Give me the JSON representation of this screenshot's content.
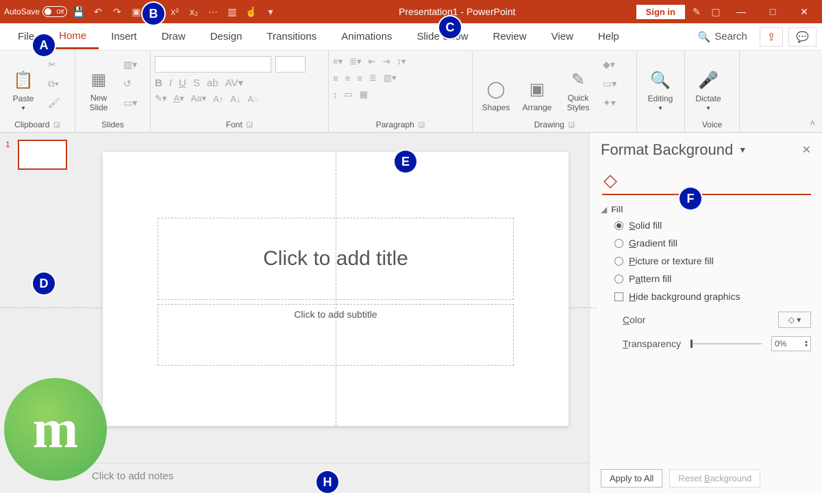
{
  "titlebar": {
    "autosave_label": "AutoSave",
    "autosave_state": "Off",
    "doc_title": "Presentation1 - PowerPoint",
    "signin": "Sign in"
  },
  "menu": {
    "tabs": [
      "File",
      "Home",
      "Insert",
      "Draw",
      "Design",
      "Transitions",
      "Animations",
      "Slide Show",
      "Review",
      "View",
      "Help"
    ],
    "active": "Home",
    "search": "Search"
  },
  "groups": {
    "clipboard": {
      "label": "Clipboard",
      "paste": "Paste"
    },
    "slides": {
      "label": "Slides",
      "newslide": "New\nSlide"
    },
    "font": {
      "label": "Font"
    },
    "paragraph": {
      "label": "Paragraph"
    },
    "drawing": {
      "label": "Drawing",
      "shapes": "Shapes",
      "arrange": "Arrange",
      "quick": "Quick\nStyles"
    },
    "editing": {
      "label": "Editing"
    },
    "voice": {
      "label": "Voice",
      "dictate": "Dictate"
    }
  },
  "thumbs": {
    "first_num": "1"
  },
  "slide": {
    "title_placeholder": "Click to add title",
    "subtitle_placeholder": "Click to add subtitle"
  },
  "notes": {
    "placeholder": "Click to add notes"
  },
  "pane": {
    "title": "Format Background",
    "fill_section": "Fill",
    "solid": "Solid fill",
    "gradient": "Gradient fill",
    "picture": "Picture or texture fill",
    "pattern": "Pattern fill",
    "hide": "Hide background graphics",
    "color_label": "Color",
    "transparency_label": "Transparency",
    "transparency_value": "0%",
    "apply_all": "Apply to All",
    "reset": "Reset Background"
  },
  "annotations": {
    "A": "A",
    "B": "B",
    "C": "C",
    "D": "D",
    "E": "E",
    "F": "F",
    "H": "H"
  }
}
